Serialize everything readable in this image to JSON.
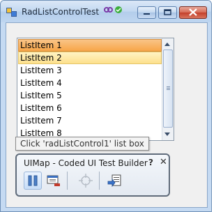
{
  "window": {
    "title": "RadListControlTest"
  },
  "listbox": {
    "items": [
      {
        "label": "ListItem 1",
        "state": "selected"
      },
      {
        "label": "ListItem 2",
        "state": "hover"
      },
      {
        "label": "ListItem 3",
        "state": "normal"
      },
      {
        "label": "ListItem 4",
        "state": "normal"
      },
      {
        "label": "ListItem 5",
        "state": "normal"
      },
      {
        "label": "ListItem 6",
        "state": "normal"
      },
      {
        "label": "ListItem 7",
        "state": "normal"
      },
      {
        "label": "ListItem 8",
        "state": "normal"
      }
    ]
  },
  "tooltip": {
    "text": "Click 'radListControl1' list box"
  },
  "uimap_toolbar": {
    "title": "UIMap - Coded UI Test Builder",
    "help_label": "?",
    "close_label": "✕"
  },
  "colors": {
    "selected_item": "#f7a649",
    "hover_item": "#fde08c",
    "title_bar": "#c2d8f1",
    "close_button": "#c3402b"
  }
}
